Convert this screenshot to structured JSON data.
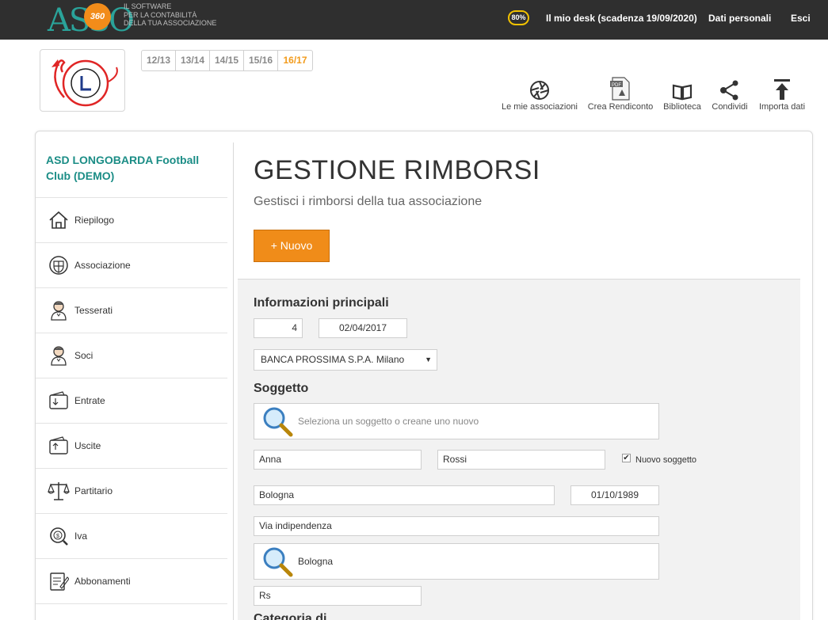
{
  "header": {
    "logo_text": "ASSO",
    "logo_badge": "360",
    "tagline": [
      "IL SOFTWARE",
      "PER LA CONTABILITÀ",
      "DELLA TUA ASSOCIAZIONE"
    ],
    "progress": "80%",
    "desk_label": "Il mio desk (scadenza 19/09/2020)",
    "personal_label": "Dati personali",
    "logout_label": "Esci"
  },
  "years": [
    {
      "label": "12/13",
      "active": false
    },
    {
      "label": "13/14",
      "active": false
    },
    {
      "label": "14/15",
      "active": false
    },
    {
      "label": "15/16",
      "active": false
    },
    {
      "label": "16/17",
      "active": true
    }
  ],
  "actions": [
    {
      "label": "Le mie associazioni",
      "icon": "aperture-icon"
    },
    {
      "label": "Crea Rendiconto",
      "icon": "pdf-document-icon"
    },
    {
      "label": "Biblioteca",
      "icon": "open-book-icon"
    },
    {
      "label": "Condividi",
      "icon": "share-icon"
    },
    {
      "label": "Importa dati",
      "icon": "upload-icon"
    }
  ],
  "sidebar": {
    "club_name": "ASD LONGOBARDA Football Club (DEMO)",
    "items": [
      {
        "label": "Riepilogo",
        "icon": "house-icon"
      },
      {
        "label": "Associazione",
        "icon": "shield-icon"
      },
      {
        "label": "Tesserati",
        "icon": "person-icon"
      },
      {
        "label": "Soci",
        "icon": "person-icon"
      },
      {
        "label": "Entrate",
        "icon": "wallet-in-icon"
      },
      {
        "label": "Uscite",
        "icon": "wallet-out-icon"
      },
      {
        "label": "Partitario",
        "icon": "scales-icon"
      },
      {
        "label": "Iva",
        "icon": "coin-search-icon"
      },
      {
        "label": "Abbonamenti",
        "icon": "notepad-icon"
      }
    ]
  },
  "main": {
    "title": "GESTIONE RIMBORSI",
    "subtitle": "Gestisci i rimborsi della tua associazione",
    "new_button": "+ Nuovo"
  },
  "form": {
    "section_main": "Informazioni principali",
    "number": "4",
    "date": "02/04/2017",
    "bank": "BANCA PROSSIMA S.P.A. Milano",
    "section_subject": "Soggetto",
    "subject_search_placeholder": "Seleziona un soggetto o creane uno nuovo",
    "first_name": "Anna",
    "last_name": "Rossi",
    "new_subject_label": "Nuovo soggetto",
    "new_subject_checked": true,
    "birth_place": "Bologna",
    "birth_date": "01/10/1989",
    "address": "Via indipendenza",
    "city": "Bologna",
    "extra": "Rs",
    "section_next": "Categoria di ... ... ... ... ..."
  },
  "colors": {
    "topbar": "#2f2f2f",
    "accent_orange": "#f08c19",
    "teal": "#1b8d86",
    "form_bg": "#f2f2f2"
  }
}
